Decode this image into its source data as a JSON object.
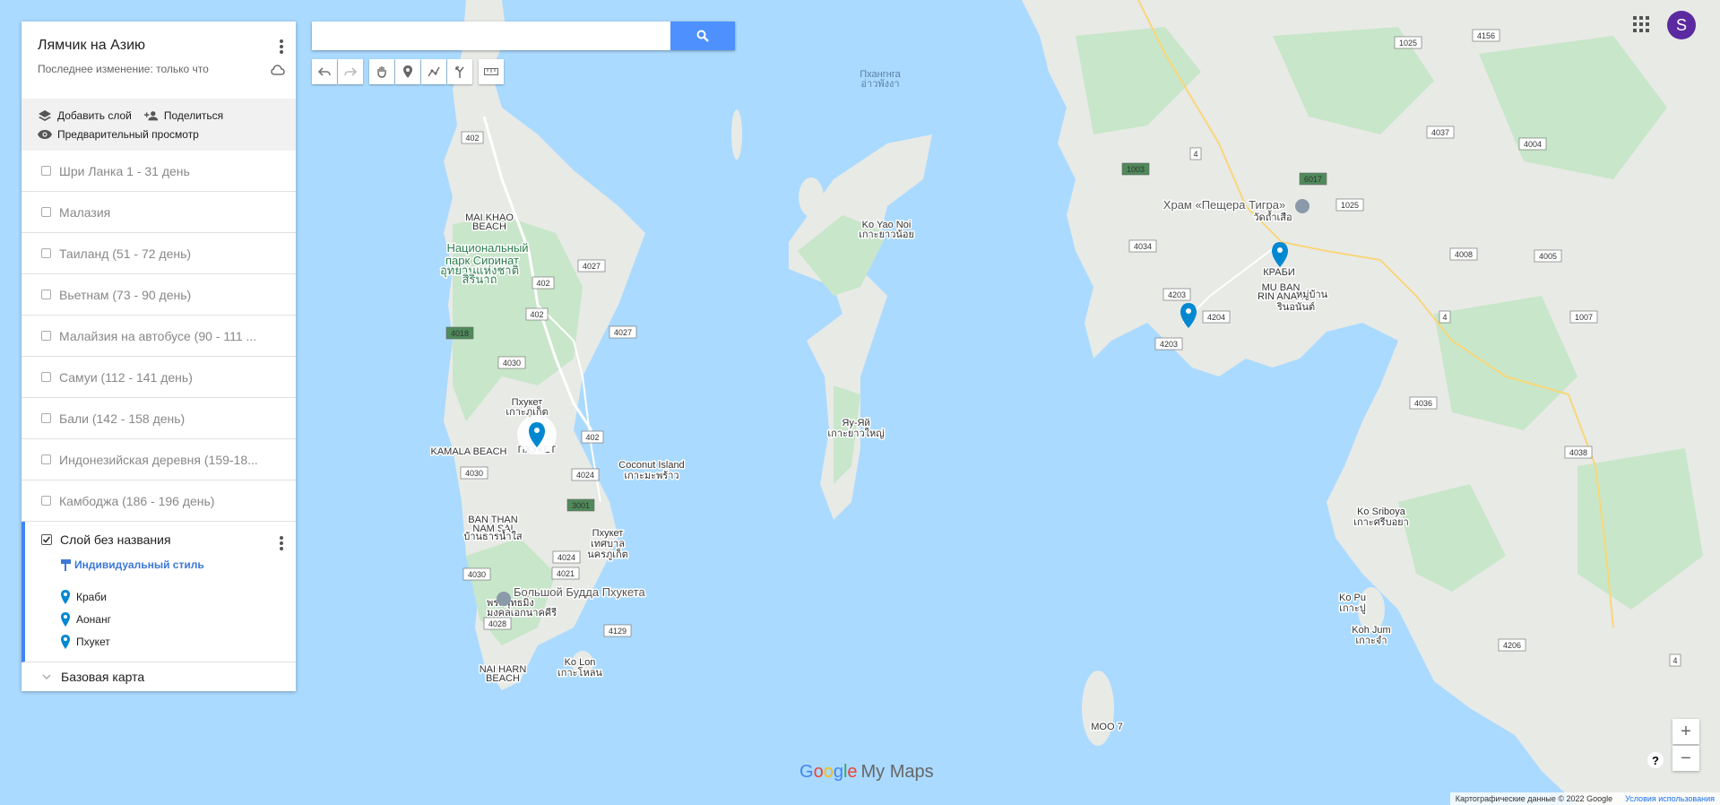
{
  "map": {
    "labels": {
      "phang_nga": "Пхангнга",
      "phang_nga_thai": "อ่าวพังงา",
      "mai_khao_1": "MAI KHAO",
      "mai_khao_2": "BEACH",
      "sirinat_1": "Национальный",
      "sirinat_2": "парк Сиринат",
      "sirinat_thai_1": "อุทยานแห่งชาติ",
      "sirinat_thai_2": "สิรินาถ",
      "ko_yao_noi": "Ko Yao Noi",
      "ko_yao_noi_thai": "เกาะยาวน้อย",
      "ko_yao_yai": "Яу-Яй",
      "ko_yao_yai_thai": "เกาะยาวใหญ่",
      "phuket_island": "Пхукет",
      "phuket_island_thai": "เกาะภูเก็ต",
      "phuket_city_faded": "ПХУКЕТ",
      "kamala_beach": "KAMALA BEACH",
      "coconut_island": "Coconut Island",
      "coconut_island_thai": "เกาะมะพร้าว",
      "ban_than_1": "BAN THAN",
      "ban_than_2": "NAM SAI",
      "ban_than_thai": "บ้านธารน้ำใส",
      "phuket_town": "Пхукет",
      "phuket_town_thai_1": "เทศบาล",
      "phuket_town_thai_2": "นครภูเก็ต",
      "big_buddha": "Большой Будда Пхукета",
      "big_buddha_thai_1": "พระพุทธมิ่ง",
      "big_buddha_thai_2": "มงคลเอกนาคคีรี",
      "nai_harn_1": "NAI HARN",
      "nai_harn_2": "BEACH",
      "ko_lon": "Ko Lon",
      "ko_lon_thai": "เกาะโหลน",
      "moo7": "MOO 7",
      "tiger_cave": "Храм «Пещера Тигра»",
      "tiger_cave_thai": "วัดถ้ำเสือ",
      "krabi": "КРАБИ",
      "mu_ban_1": "MU BAN",
      "mu_ban_2": "RIN ANAN",
      "mu_ban_thai_1": "หมู่บ้าน",
      "mu_ban_thai_2": "รินอนันต์",
      "ko_sriboya": "Ko Sriboya",
      "ko_sriboya_thai": "เกาะศรีบอยา",
      "ko_pu": "Ko Pu",
      "ko_pu_thai": "เกาะปู",
      "koh_jum": "Koh Jum",
      "koh_jum_thai": "เกาะจำ"
    },
    "road_numbers": [
      "402",
      "4027",
      "402",
      "402",
      "4027",
      "4018",
      "4030",
      "402",
      "4024",
      "3001",
      "4030",
      "4024",
      "4021",
      "4030",
      "4028",
      "4129",
      "1025",
      "4156",
      "4037",
      "4004",
      "4",
      "1003",
      "6017",
      "1025",
      "4034",
      "4008",
      "4005",
      "4203",
      "4204",
      "4203",
      "4",
      "1007",
      "4036",
      "4038",
      "4206",
      "4"
    ]
  },
  "panel": {
    "title": "Лямчик на Азию",
    "subtitle": "Последнее изменение: только что",
    "add_layer": "Добавить слой",
    "share": "Поделиться",
    "preview": "Предварительный просмотр",
    "layers": [
      "Шри Ланка 1 - 31 день",
      "Малазия",
      "Таиланд (51 - 72 день)",
      "Вьетнам (73 - 90 день)",
      "Малайзия на автобусе (90 - 111 ...",
      "Самуи (112 - 141 день)",
      "Бали (142 - 158 день)",
      "Индонезийская деревня (159-18...",
      "Камбоджа (186 - 196 день)"
    ],
    "active_layer": {
      "name": "Слой без названия",
      "style": "Индивидуальный стиль",
      "places": [
        "Краби",
        "Аонанг",
        "Пхукет"
      ]
    },
    "basemap": "Базовая карта"
  },
  "search": {
    "value": "",
    "placeholder": ""
  },
  "user": {
    "initial": "S"
  },
  "branding": {
    "google": "Google",
    "product": "My Maps"
  },
  "attribution": {
    "data": "Картографические данные © 2022 Google",
    "terms": "Условия использования"
  },
  "zoom": {
    "in": "+",
    "out": "−"
  },
  "help": "?",
  "colors": {
    "water": "#aadaff",
    "land": "#e8eae6",
    "forest": "#c8e6c9",
    "marker": "#0288d1",
    "accent": "#4285f4",
    "avatar": "#5b2aa0"
  }
}
